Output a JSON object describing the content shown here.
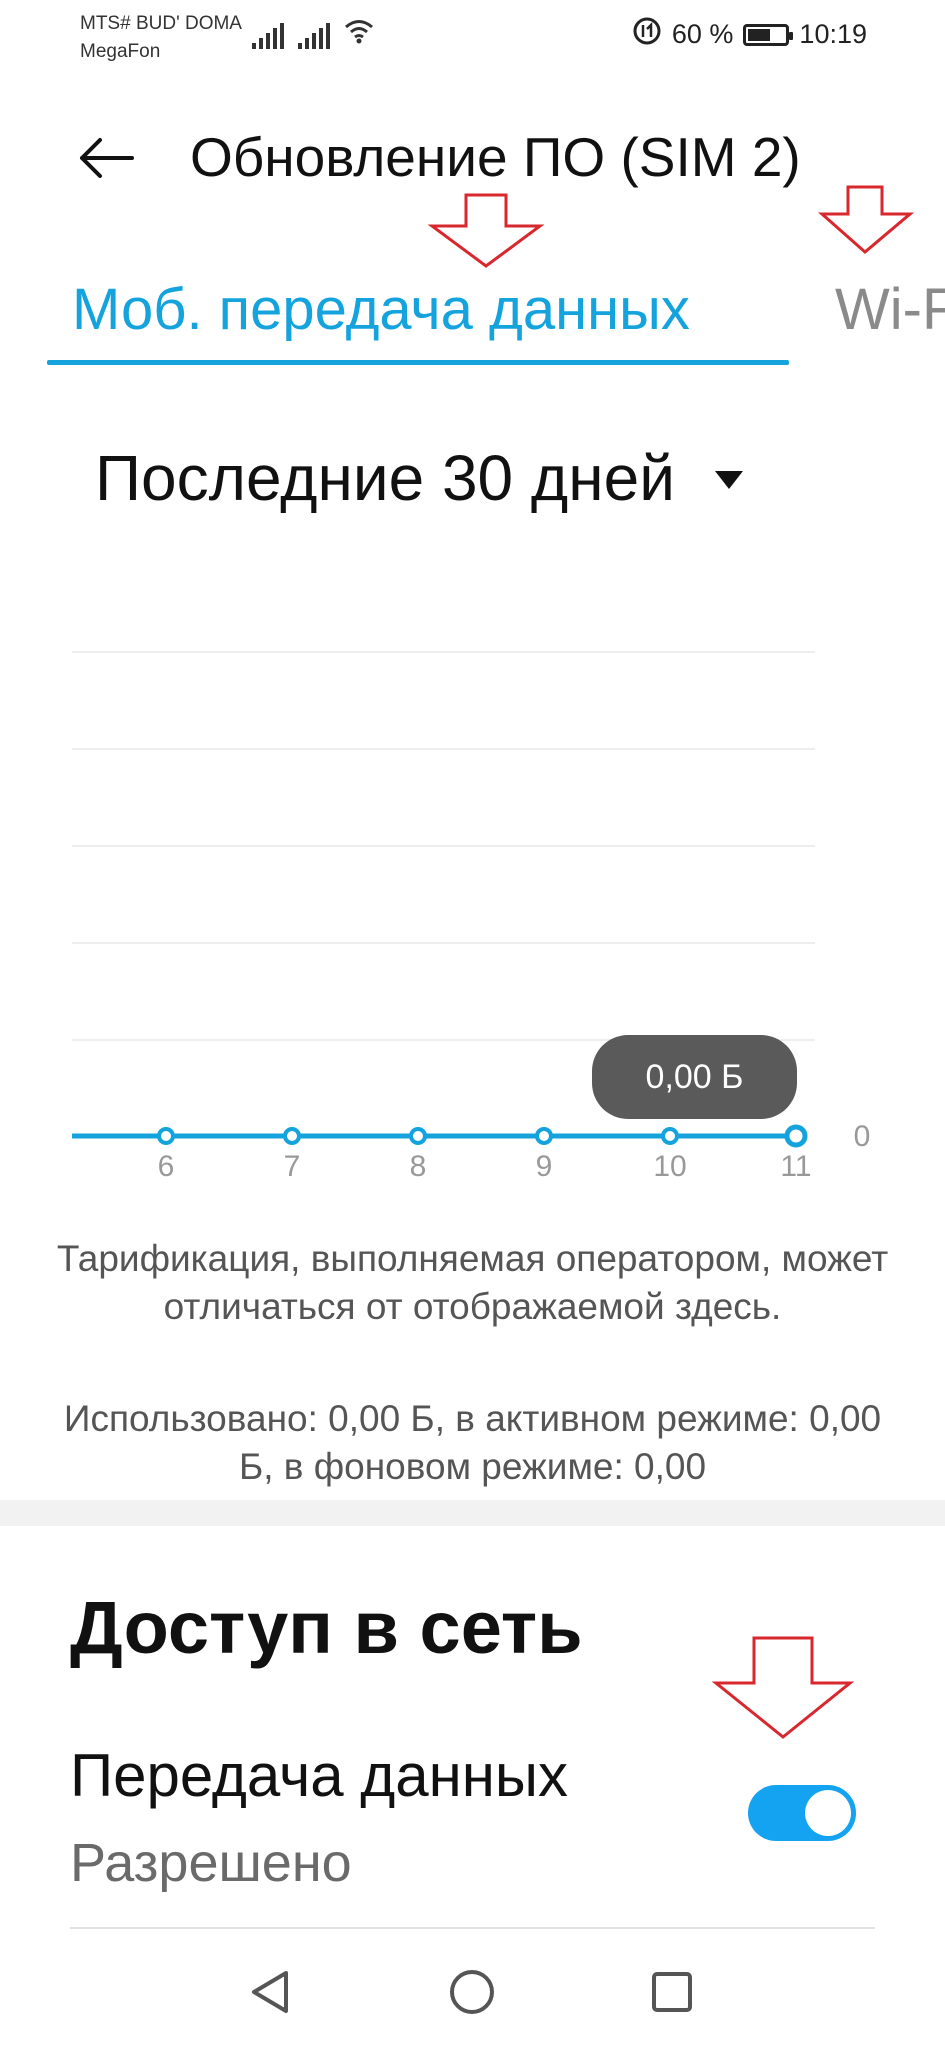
{
  "status_bar": {
    "carrier_1": "MTS# BUD' DOMA",
    "carrier_2": "MegaFon",
    "battery_percent": "60 %",
    "battery_level": 0.6,
    "time": "10:19"
  },
  "header": {
    "title": "Обновление ПО (SIM 2)",
    "back_icon": "arrow-left-icon"
  },
  "tabs": [
    {
      "label": "Моб. передача данных",
      "active": true
    },
    {
      "label": "Wi-Fi",
      "active": false
    }
  ],
  "period": {
    "selected": "Последние 30 дней"
  },
  "chart_data": {
    "type": "line",
    "x": [
      6,
      7,
      8,
      9,
      10,
      11
    ],
    "tick_labels": [
      "6",
      "7",
      "8",
      "9",
      "10",
      "11"
    ],
    "y_axis_label": "0",
    "series": [
      {
        "values": [
          0,
          0,
          0,
          0,
          0,
          0
        ]
      }
    ],
    "highlighted_point": {
      "x": 11,
      "label": "0,00 Б"
    },
    "grid": true,
    "line_color": "#14a3dc"
  },
  "notes": {
    "billing": "Тарификация, выполняемая оператором, может отличаться от отображаемой здесь.",
    "usage": "Использовано: 0,00 Б, в активном режиме: 0,00 Б, в фоновом режиме: 0,00"
  },
  "network_access": {
    "title": "Доступ в сеть",
    "data_transfer_label": "Передача данных",
    "data_transfer_status": "Разрешено",
    "data_transfer_enabled": true
  },
  "nav_bar": {
    "back_icon": "triangle-back-icon",
    "home_icon": "circle-home-icon",
    "recents_icon": "square-recents-icon"
  },
  "colors": {
    "accent": "#14a3dc",
    "toggle_on": "#14a3f0",
    "annotation": "#d9272e"
  }
}
